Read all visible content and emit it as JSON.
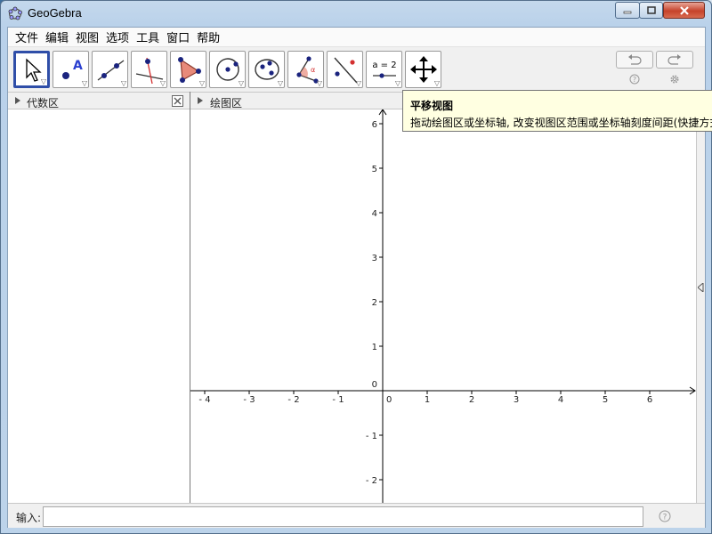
{
  "window": {
    "title": "GeoGebra",
    "app_icon": "geogebra-icon"
  },
  "menu": [
    "文件",
    "编辑",
    "视图",
    "选项",
    "工具",
    "窗口",
    "帮助"
  ],
  "toolbar": {
    "tools": [
      {
        "name": "move-tool",
        "active": true
      },
      {
        "name": "point-tool",
        "active": false
      },
      {
        "name": "line-tool",
        "active": false
      },
      {
        "name": "perpendicular-line-tool",
        "active": false
      },
      {
        "name": "polygon-tool",
        "active": false
      },
      {
        "name": "circle-tool",
        "active": false
      },
      {
        "name": "conic-tool",
        "active": false
      },
      {
        "name": "angle-tool",
        "active": false
      },
      {
        "name": "reflect-tool",
        "active": false
      },
      {
        "name": "slider-tool",
        "active": false
      },
      {
        "name": "move-graphics-view-tool",
        "active": false
      }
    ],
    "slider_icon_text": "a = 2"
  },
  "algebra_view": {
    "title": "代数区"
  },
  "graphics_view": {
    "title": "绘图区",
    "x_ticks": [
      "-4",
      "-3",
      "-2",
      "-1",
      "0",
      "1",
      "2",
      "3",
      "4",
      "5",
      "6"
    ],
    "y_ticks": [
      "6",
      "5",
      "4",
      "3",
      "2",
      "1",
      "0",
      "-1",
      "-2"
    ]
  },
  "tooltip": {
    "title": "平移视图",
    "text": "拖动绘图区或坐标轴, 改变视图区范围或坐标轴刻度间距(快捷方式"
  },
  "input_bar": {
    "label": "输入:",
    "value": "",
    "placeholder": ""
  },
  "colors": {
    "accent": "#2f4ea8",
    "point": "#1a237e",
    "tooltip_bg": "#ffffe1"
  }
}
